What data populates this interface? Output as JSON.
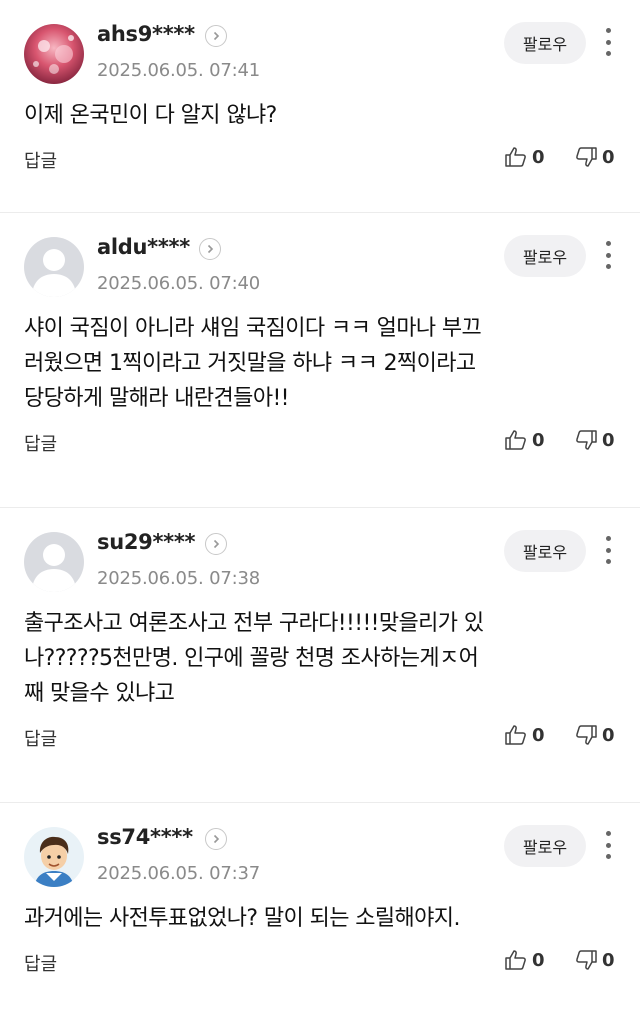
{
  "actions": {
    "follow_label": "팔로우",
    "reply_label": "답글"
  },
  "comments": [
    {
      "username": "ahs9****",
      "date": "2025.06.05. 07:41",
      "text": "이제 온국민이 다 알지 않냐?",
      "likes": "0",
      "dislikes": "0",
      "avatar": "pink-abstract-photo"
    },
    {
      "username": "aldu****",
      "date": "2025.06.05. 07:40",
      "text": "샤이 국짐이 아니라 섀임 국짐이다 ㅋㅋ 얼마나 부끄\n러웠으면 1찍이라고 거짓말을 하냐 ㅋㅋ 2찍이라고\n당당하게 말해라 내란견들아!!",
      "likes": "0",
      "dislikes": "0",
      "avatar": "default-person"
    },
    {
      "username": "su29****",
      "date": "2025.06.05. 07:38",
      "text": "출구조사고 여론조사고 전부 구라다!!!!!맞을리가 있\n나?????5천만명. 인구에 꼴랑 천명 조사하는게ㅈ어\n째 맞을수 있냐고",
      "likes": "0",
      "dislikes": "0",
      "avatar": "default-person"
    },
    {
      "username": "ss74****",
      "date": "2025.06.05. 07:37",
      "text": "과거에는 사전투표없었나? 말이 되는 소릴해야지.",
      "likes": "0",
      "dislikes": "0",
      "avatar": "cartoon-boy"
    }
  ]
}
